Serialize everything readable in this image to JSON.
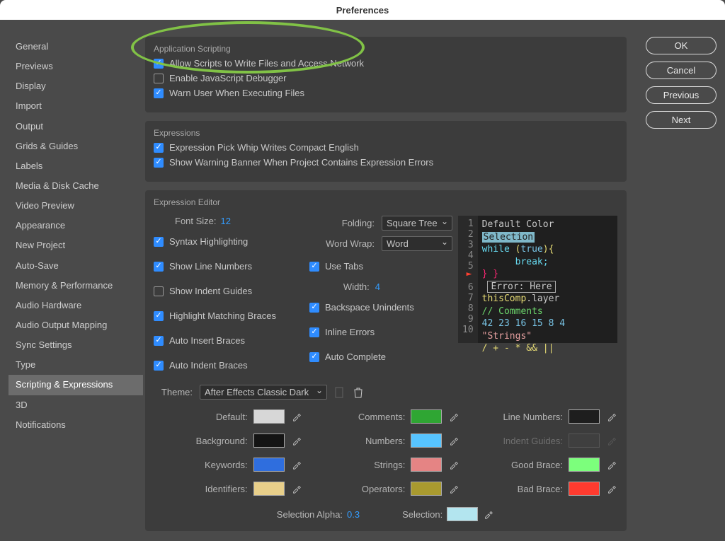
{
  "title": "Preferences",
  "buttons": {
    "ok": "OK",
    "cancel": "Cancel",
    "previous": "Previous",
    "next": "Next"
  },
  "sidebar": {
    "items": [
      "General",
      "Previews",
      "Display",
      "Import",
      "Output",
      "Grids & Guides",
      "Labels",
      "Media & Disk Cache",
      "Video Preview",
      "Appearance",
      "New Project",
      "Auto-Save",
      "Memory & Performance",
      "Audio Hardware",
      "Audio Output Mapping",
      "Sync Settings",
      "Type",
      "Scripting & Expressions",
      "3D",
      "Notifications"
    ],
    "active_index": 17
  },
  "application_scripting": {
    "title": "Application Scripting",
    "allow_write": {
      "label": "Allow Scripts to Write Files and Access Network",
      "checked": true
    },
    "enable_debugger": {
      "label": "Enable JavaScript Debugger",
      "checked": false
    },
    "warn_exec": {
      "label": "Warn User When Executing Files",
      "checked": true
    }
  },
  "expressions": {
    "title": "Expressions",
    "compact_english": {
      "label": "Expression Pick Whip Writes Compact English",
      "checked": true
    },
    "show_warning": {
      "label": "Show Warning Banner When Project Contains Expression Errors",
      "checked": true
    }
  },
  "editor": {
    "title": "Expression Editor",
    "font_size_label": "Font Size:",
    "font_size": "12",
    "folding_label": "Folding:",
    "folding_value": "Square Tree",
    "word_wrap_label": "Word Wrap:",
    "word_wrap_value": "Word",
    "use_tabs": {
      "label": "Use Tabs",
      "checked": true
    },
    "width_label": "Width:",
    "width_value": "4",
    "syntax_hl": {
      "label": "Syntax Highlighting",
      "checked": true
    },
    "line_numbers": {
      "label": "Show Line Numbers",
      "checked": true
    },
    "indent_guides": {
      "label": "Show Indent Guides",
      "checked": false
    },
    "match_braces": {
      "label": "Highlight Matching Braces",
      "checked": true
    },
    "auto_insert": {
      "label": "Auto Insert Braces",
      "checked": true
    },
    "auto_indent": {
      "label": "Auto Indent Braces",
      "checked": true
    },
    "backspace": {
      "label": "Backspace Unindents",
      "checked": true
    },
    "inline_errors": {
      "label": "Inline Errors",
      "checked": true
    },
    "auto_complete": {
      "label": "Auto Complete",
      "checked": true
    }
  },
  "preview": {
    "l1": "Default Color",
    "l2": "Selection",
    "l3a": "while",
    "l3b": "(",
    "l3c": "true",
    "l3d": "){",
    "l4": "break;",
    "l5": "} }",
    "err": "Error: Here",
    "l6a": "thisComp",
    "l6b": ".layer",
    "l7": "// Comments",
    "l8": "42 23 16 15 8 4",
    "l9": "\"Strings\"",
    "l10": "/ + - * && ||"
  },
  "theme": {
    "label": "Theme:",
    "value": "After Effects Classic Dark",
    "rows": [
      {
        "label": "Default:",
        "color": "#d7d7d7"
      },
      {
        "label": "Comments:",
        "color": "#2fa633"
      },
      {
        "label": "Line Numbers:",
        "color": "#1e1e1e"
      },
      {
        "label": "Background:",
        "color": "#141414"
      },
      {
        "label": "Numbers:",
        "color": "#57c4ff"
      },
      {
        "label": "Indent Guides:",
        "color": "#4a4a4a",
        "disabled": true
      },
      {
        "label": "Keywords:",
        "color": "#2f6ede"
      },
      {
        "label": "Strings:",
        "color": "#e58484"
      },
      {
        "label": "Good Brace:",
        "color": "#7cff7c"
      },
      {
        "label": "Identifiers:",
        "color": "#e8cf8a"
      },
      {
        "label": "Operators:",
        "color": "#a99a2f"
      },
      {
        "label": "Bad Brace:",
        "color": "#ff3b2f"
      }
    ],
    "selection_alpha_label": "Selection Alpha:",
    "selection_alpha": "0.3",
    "selection_label": "Selection:",
    "selection_color": "#b3e5ef"
  }
}
